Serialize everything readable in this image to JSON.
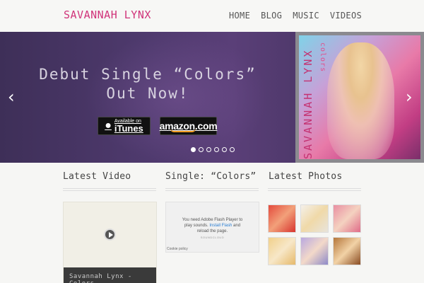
{
  "header": {
    "logo": "SAVANNAH LYNX",
    "nav": [
      "HOME",
      "BLOG",
      "MUSIC",
      "VIDEOS"
    ]
  },
  "hero": {
    "line1": "Debut Single “Colors”",
    "line2": "Out Now!",
    "itunes_small": "Available on",
    "itunes_big": "iTunes",
    "amazon": "amazon.com",
    "prev_arrow": "‹",
    "next_arrow": "›",
    "slide_count": 6,
    "active_slide": 1,
    "cover_name": "SAVANNAH LYNX",
    "cover_sub": "colors"
  },
  "columns": {
    "video_title": "Latest Video",
    "single_title": "Single: “Colors”",
    "photos_title": "Latest Photos"
  },
  "video": {
    "caption": "Savannah Lynx - Colors"
  },
  "flash": {
    "line1": "You need Adobe Flash Player to",
    "line2": "play sounds.",
    "link": "Install Flash",
    "line2b": "and",
    "line3": "reload the page.",
    "provider": "SOUNDCLOUD",
    "cookie": "Cookie policy"
  },
  "colors": {
    "accent": "#d0347a",
    "hero_bg": "#4f3a6e"
  },
  "photos": [
    {
      "name": "photo-thumb-1",
      "bg": "linear-gradient(135deg,#e44a3c,#f2a07a 50%,#d8342e)"
    },
    {
      "name": "photo-thumb-2",
      "bg": "linear-gradient(135deg,#f4f0ea,#f0d9a8 50%,#e8e4dc)"
    },
    {
      "name": "photo-thumb-3",
      "bg": "linear-gradient(135deg,#e98fa2,#f4d2c0 50%,#e06b88)"
    },
    {
      "name": "photo-thumb-4",
      "bg": "linear-gradient(135deg,#f1d08a,#f7e7c8 50%,#e6b96a)"
    },
    {
      "name": "photo-thumb-5",
      "bg": "linear-gradient(135deg,#b9a8e0,#f3d9c9 50%,#8e8ac9)"
    },
    {
      "name": "photo-thumb-6",
      "bg": "linear-gradient(135deg,#b5763a,#f2d2a6 50%,#8a4c22)"
    }
  ]
}
